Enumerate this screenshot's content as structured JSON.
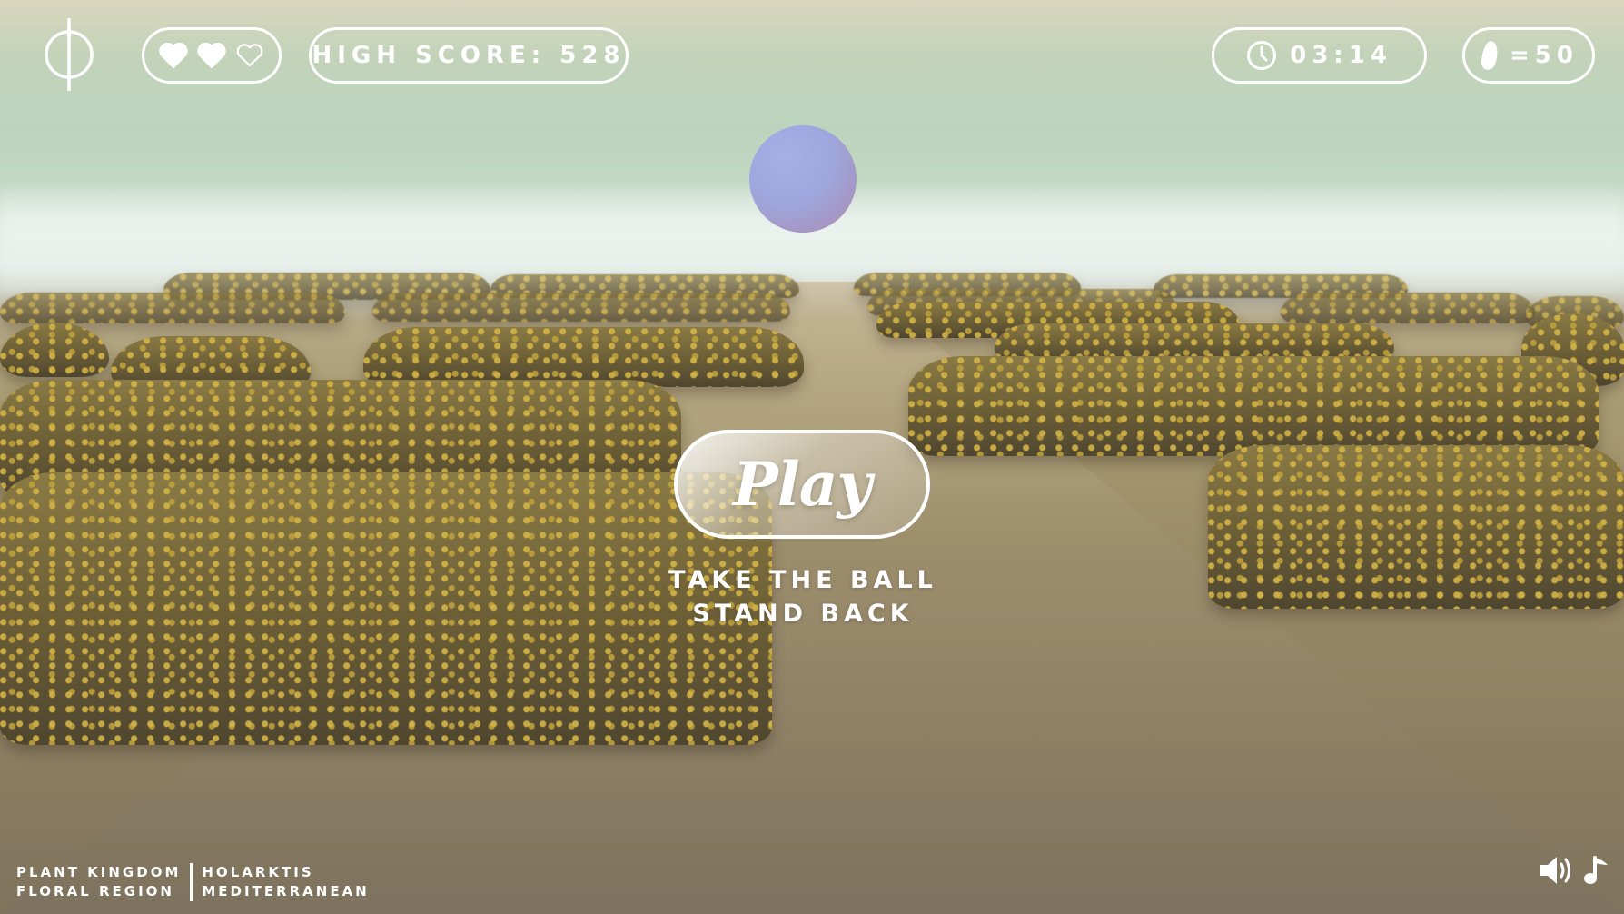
{
  "hud": {
    "lives": {
      "total": 3,
      "filled": 2
    },
    "high_score": "HIGH SCORE: 528",
    "timer": "03:14",
    "coins": "=50"
  },
  "main": {
    "play_label": "Play",
    "instruction_line1": "TAKE THE BALL",
    "instruction_line2": "STAND BACK"
  },
  "footer": {
    "kingdom_label": "PLANT KINGDOM",
    "region_label": "FLORAL REGION",
    "kingdom_value": "HOLARKTIS",
    "region_value": "MEDITERRANEAN"
  },
  "icons": {
    "logo": "phi-logo-icon",
    "heart": "heart-icon",
    "clock": "clock-icon",
    "coin": "seed-icon",
    "sound": "speaker-icon",
    "music": "music-note-icon"
  },
  "colors": {
    "hud": "#ffffff",
    "ball_top": "#a6b0e6",
    "ball_bottom": "#b88aa2"
  }
}
